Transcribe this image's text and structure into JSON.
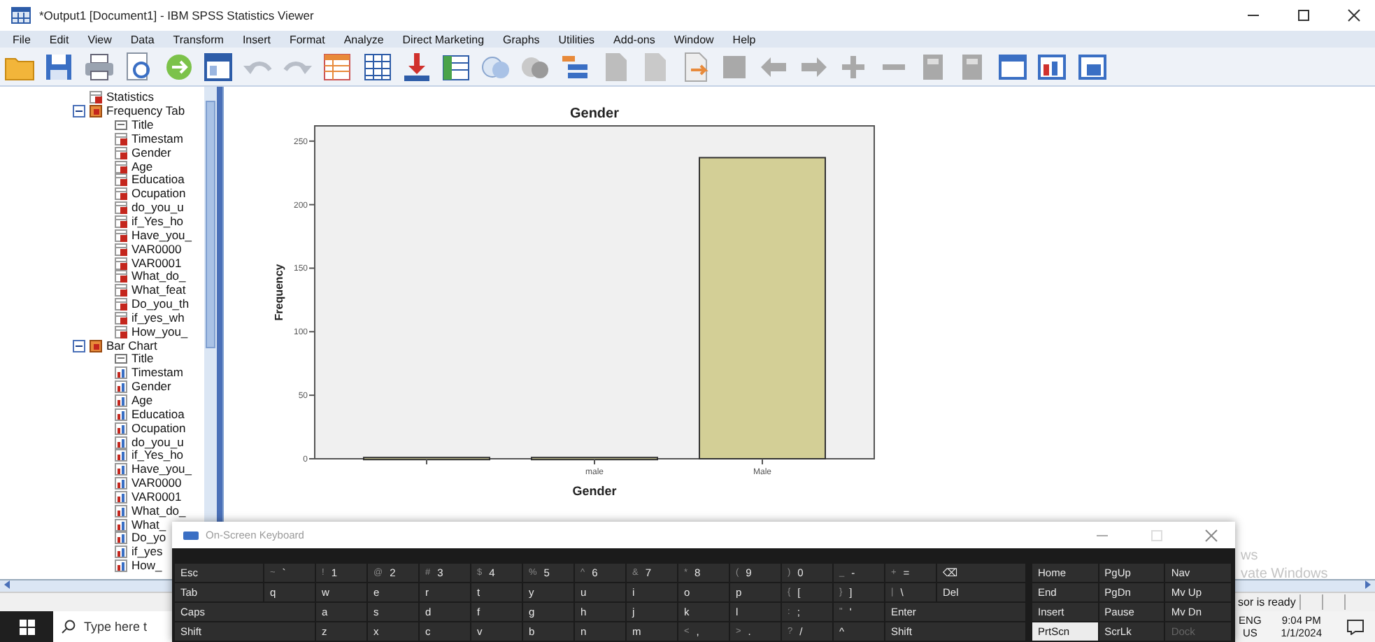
{
  "window": {
    "title": "*Output1 [Document1] - IBM SPSS Statistics Viewer"
  },
  "menu": [
    "File",
    "Edit",
    "View",
    "Data",
    "Transform",
    "Insert",
    "Format",
    "Analyze",
    "Direct Marketing",
    "Graphs",
    "Utilities",
    "Add-ons",
    "Window",
    "Help"
  ],
  "outline": {
    "items": [
      {
        "label": "Statistics",
        "kind": "table"
      },
      {
        "label": "Frequency Tab",
        "kind": "book",
        "expanded": true,
        "children": [
          {
            "label": "Title",
            "kind": "title"
          },
          {
            "label": "Timestam",
            "kind": "table"
          },
          {
            "label": "Gender",
            "kind": "table"
          },
          {
            "label": "Age",
            "kind": "table"
          },
          {
            "label": "Educatioa",
            "kind": "table"
          },
          {
            "label": "Ocupation",
            "kind": "table"
          },
          {
            "label": "do_you_u",
            "kind": "table"
          },
          {
            "label": "if_Yes_ho",
            "kind": "table"
          },
          {
            "label": "Have_you_",
            "kind": "table"
          },
          {
            "label": "VAR0000",
            "kind": "table"
          },
          {
            "label": "VAR0001",
            "kind": "table"
          },
          {
            "label": "What_do_",
            "kind": "table"
          },
          {
            "label": "What_feat",
            "kind": "table"
          },
          {
            "label": "Do_you_th",
            "kind": "table"
          },
          {
            "label": "if_yes_wh",
            "kind": "table"
          },
          {
            "label": "How_you_",
            "kind": "table"
          }
        ]
      },
      {
        "label": "Bar Chart",
        "kind": "book",
        "expanded": true,
        "children": [
          {
            "label": "Title",
            "kind": "title"
          },
          {
            "label": "Timestam",
            "kind": "chart"
          },
          {
            "label": "Gender",
            "kind": "chart"
          },
          {
            "label": "Age",
            "kind": "chart"
          },
          {
            "label": "Educatioa",
            "kind": "chart"
          },
          {
            "label": "Ocupation",
            "kind": "chart"
          },
          {
            "label": "do_you_u",
            "kind": "chart"
          },
          {
            "label": "if_Yes_ho",
            "kind": "chart"
          },
          {
            "label": "Have_you_",
            "kind": "chart"
          },
          {
            "label": "VAR0000",
            "kind": "chart"
          },
          {
            "label": "VAR0001",
            "kind": "chart"
          },
          {
            "label": "What_do_",
            "kind": "chart"
          },
          {
            "label": "What_",
            "kind": "chart"
          },
          {
            "label": "Do_yo",
            "kind": "chart"
          },
          {
            "label": "if_yes",
            "kind": "chart"
          },
          {
            "label": "How_",
            "kind": "chart"
          }
        ]
      }
    ]
  },
  "chart": {
    "chart_data": {
      "type": "bar",
      "title": "Gender",
      "xlabel": "Gender",
      "ylabel": "Frequency",
      "categories": [
        null,
        "male",
        "Male"
      ],
      "series": [
        {
          "color": "#d3cf96",
          "values": [
            1,
            1,
            237
          ]
        }
      ],
      "ylim": [
        0,
        262
      ],
      "yticks": [
        0,
        50,
        100,
        150,
        200,
        250
      ]
    }
  },
  "activation_notice": [
    "ws",
    "vate Windows"
  ],
  "status_bar": {
    "text": "sor is ready"
  },
  "on_screen_keyboard": {
    "title": "On-Screen Keyboard",
    "rows": [
      [
        {
          "label": "Esc",
          "kind": "function"
        },
        {
          "label": "`",
          "shift": "~",
          "kind": "char"
        },
        {
          "label": "1",
          "shift": "!",
          "kind": "char"
        },
        {
          "label": "2",
          "shift": "@",
          "kind": "char"
        },
        {
          "label": "3",
          "shift": "#",
          "kind": "char"
        },
        {
          "label": "4",
          "shift": "$",
          "kind": "char"
        },
        {
          "label": "5",
          "shift": "%",
          "kind": "char"
        },
        {
          "label": "6",
          "shift": "^",
          "kind": "char"
        },
        {
          "label": "7",
          "shift": "&",
          "kind": "char"
        },
        {
          "label": "8",
          "shift": "*",
          "kind": "char"
        },
        {
          "label": "9",
          "shift": "(",
          "kind": "char"
        },
        {
          "label": "0",
          "shift": ")",
          "kind": "char"
        },
        {
          "label": "-",
          "shift": "_",
          "kind": "char"
        },
        {
          "label": "=",
          "shift": "+",
          "kind": "char"
        },
        {
          "label": "⌫",
          "kind": "function"
        }
      ],
      [
        {
          "label": "Tab",
          "kind": "function"
        },
        {
          "label": "q",
          "kind": "char"
        },
        {
          "label": "w",
          "kind": "char"
        },
        {
          "label": "e",
          "kind": "char"
        },
        {
          "label": "r",
          "kind": "char"
        },
        {
          "label": "t",
          "kind": "char"
        },
        {
          "label": "y",
          "kind": "char"
        },
        {
          "label": "u",
          "kind": "char"
        },
        {
          "label": "i",
          "kind": "char"
        },
        {
          "label": "o",
          "kind": "char"
        },
        {
          "label": "p",
          "kind": "char"
        },
        {
          "label": "[",
          "shift": "{",
          "kind": "char"
        },
        {
          "label": "]",
          "shift": "}",
          "kind": "char"
        },
        {
          "label": "\\",
          "shift": "|",
          "kind": "char"
        },
        {
          "label": "Del",
          "kind": "function"
        }
      ],
      [
        {
          "label": "Caps",
          "kind": "function"
        },
        {
          "label": "a",
          "kind": "char"
        },
        {
          "label": "s",
          "kind": "char"
        },
        {
          "label": "d",
          "kind": "char"
        },
        {
          "label": "f",
          "kind": "char"
        },
        {
          "label": "g",
          "kind": "char"
        },
        {
          "label": "h",
          "kind": "char"
        },
        {
          "label": "j",
          "kind": "char"
        },
        {
          "label": "k",
          "kind": "char"
        },
        {
          "label": "l",
          "kind": "char"
        },
        {
          "label": ";",
          "shift": ":",
          "kind": "char"
        },
        {
          "label": "'",
          "shift": "\"",
          "kind": "char"
        },
        {
          "label": "Enter",
          "kind": "function"
        }
      ],
      [
        {
          "label": "Shift",
          "kind": "function"
        },
        {
          "label": "z",
          "kind": "char"
        },
        {
          "label": "x",
          "kind": "char"
        },
        {
          "label": "c",
          "kind": "char"
        },
        {
          "label": "v",
          "kind": "char"
        },
        {
          "label": "b",
          "kind": "char"
        },
        {
          "label": "n",
          "kind": "char"
        },
        {
          "label": "m",
          "kind": "char"
        },
        {
          "label": ",",
          "shift": "<",
          "kind": "char"
        },
        {
          "label": ".",
          "shift": ">",
          "kind": "char"
        },
        {
          "label": "/",
          "shift": "?",
          "kind": "char"
        },
        {
          "label": "^",
          "kind": "char"
        },
        {
          "label": "Shift",
          "kind": "function"
        }
      ]
    ],
    "nav_rows": [
      [
        {
          "label": "Home",
          "pressed": false,
          "disabled": false
        },
        {
          "label": "PgUp",
          "pressed": false,
          "disabled": false
        },
        {
          "label": "Nav",
          "pressed": false,
          "disabled": false
        }
      ],
      [
        {
          "label": "End",
          "pressed": false,
          "disabled": false
        },
        {
          "label": "PgDn",
          "pressed": false,
          "disabled": false
        },
        {
          "label": "Mv Up",
          "pressed": false,
          "disabled": false
        }
      ],
      [
        {
          "label": "Insert",
          "pressed": false,
          "disabled": false
        },
        {
          "label": "Pause",
          "pressed": false,
          "disabled": false
        },
        {
          "label": "Mv Dn",
          "pressed": false,
          "disabled": false
        }
      ],
      [
        {
          "label": "PrtScn",
          "pressed": true,
          "disabled": false
        },
        {
          "label": "ScrLk",
          "pressed": false,
          "disabled": false
        },
        {
          "label": "Dock",
          "pressed": false,
          "disabled": true
        }
      ]
    ]
  },
  "taskbar": {
    "search_placeholder": "Type here t",
    "language": "ENG",
    "region": "US",
    "time": "9:04 PM",
    "date": "1/1/2024"
  }
}
